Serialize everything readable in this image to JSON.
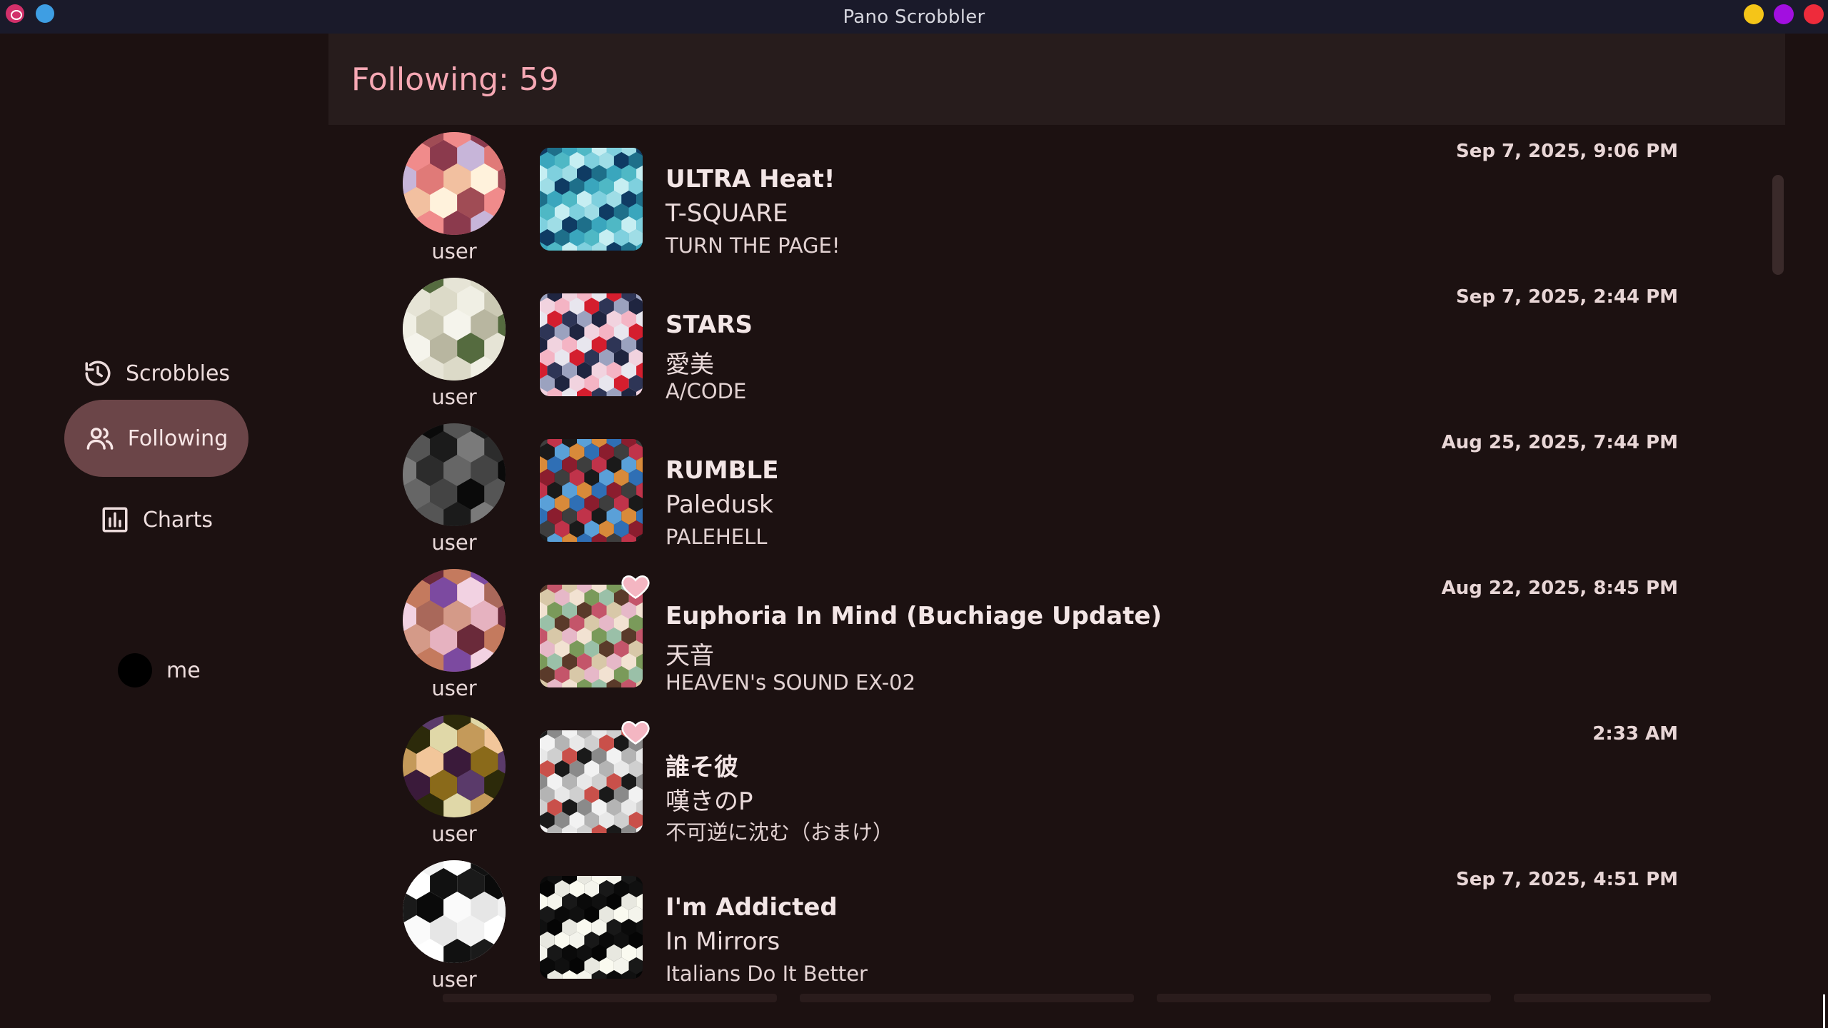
{
  "window": {
    "title": "Pano Scrobbler"
  },
  "sidebar": {
    "items": [
      {
        "label": "Scrobbles",
        "icon": "history-icon"
      },
      {
        "label": "Following",
        "icon": "people-icon",
        "active": true
      },
      {
        "label": "Charts",
        "icon": "bar-chart-icon"
      }
    ],
    "profile": {
      "label": "me"
    }
  },
  "header": {
    "title": "Following: 59"
  },
  "entries": [
    {
      "user": "user",
      "track": "ULTRA Heat!",
      "artist": "T-SQUARE",
      "album": "TURN THE PAGE!",
      "time": "Sep 7, 2025, 9:06 PM",
      "loved": false,
      "avatar_colors": [
        "#f08b8b",
        "#e07a78",
        "#a04c55",
        "#c7b5d9",
        "#fff2dc",
        "#8b3a4d",
        "#f2c0a0"
      ],
      "cover_colors": [
        "#3aa6bd",
        "#7fd0de",
        "#1e6f8a",
        "#c6eef2",
        "#0f3b63",
        "#4fb8c5",
        "#9fdde6"
      ]
    },
    {
      "user": "user",
      "track": "STARS",
      "artist": "愛美",
      "album": "A/CODE",
      "time": "Sep 7, 2025, 2:44 PM",
      "loved": false,
      "avatar_colors": [
        "#e6e4d6",
        "#cbc9b4",
        "#556b3f",
        "#f0efe4",
        "#b8b6a0",
        "#dcdac8",
        "#f5f4ec"
      ],
      "cover_colors": [
        "#f1d3df",
        "#d41e2e",
        "#1f2540",
        "#e8e6ee",
        "#9ba2bf",
        "#f4b4c4",
        "#2e3556"
      ]
    },
    {
      "user": "user",
      "track": "RUMBLE",
      "artist": "Paledusk",
      "album": "PALEHELL",
      "time": "Aug 25, 2025, 7:44 PM",
      "loved": false,
      "avatar_colors": [
        "#555555",
        "#2c2c2c",
        "#0a0a0a",
        "#7a7a7a",
        "#444444",
        "#1b1b1b",
        "#666666"
      ],
      "cover_colors": [
        "#1a1a1a",
        "#2f6fb5",
        "#c0334a",
        "#d88a3a",
        "#3e3e3e",
        "#5aa0d8",
        "#8b1d2e"
      ]
    },
    {
      "user": "user",
      "track": "Euphoria In Mind (Buchiage Update)",
      "artist": "天音",
      "album": "HEAVEN's SOUND EX-02",
      "time": "Aug 22, 2025, 8:45 PM",
      "loved": true,
      "avatar_colors": [
        "#c47a5e",
        "#a9685a",
        "#6a2a3a",
        "#f2d2e2",
        "#e6b2c0",
        "#7c4aa0",
        "#d49a88"
      ],
      "cover_colors": [
        "#d8c8a8",
        "#7a9a5a",
        "#c4556a",
        "#f2e2d2",
        "#5a3a2a",
        "#e6b8c8",
        "#9ac0a8"
      ]
    },
    {
      "user": "user",
      "track": "誰そ彼",
      "artist": "嘆きのP",
      "album": "不可逆に沈む（おまけ）",
      "time": "2:33 AM",
      "loved": true,
      "avatar_colors": [
        "#2c2a0a",
        "#f2c69a",
        "#5a3a6a",
        "#c49a5a",
        "#8a6a1a",
        "#e0d8a8",
        "#3a1a3a"
      ],
      "cover_colors": [
        "#f2f2f2",
        "#cfcfcf",
        "#8a8a8a",
        "#e8e8e8",
        "#1a1a1a",
        "#b4b4b4",
        "#c9504a"
      ]
    },
    {
      "user": "user",
      "track": "I'm Addicted",
      "artist": "In Mirrors",
      "album": "Italians Do It Better",
      "time": "Sep 7, 2025, 4:51 PM",
      "loved": false,
      "avatar_colors": [
        "#ffffff",
        "#0a0a0a",
        "#f2f2f2",
        "#1a1a1a",
        "#e6e6e6",
        "#111111",
        "#fafafa"
      ],
      "cover_colors": [
        "#050505",
        "#f4f4ec",
        "#101010",
        "#fafaf0",
        "#0a0a0a",
        "#e8e8e0",
        "#181818"
      ]
    }
  ]
}
